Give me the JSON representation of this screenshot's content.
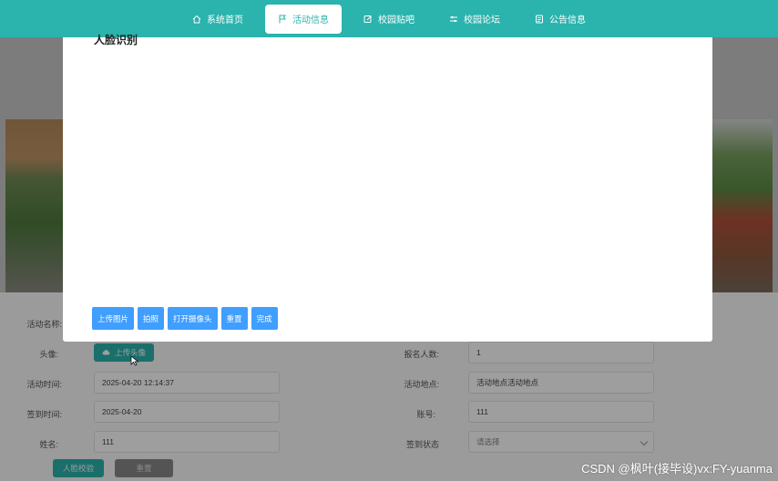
{
  "nav": {
    "items": [
      {
        "label": "系统首页",
        "icon": "home-icon",
        "active": false
      },
      {
        "label": "活动信息",
        "icon": "flag-icon",
        "active": true
      },
      {
        "label": "校园贴吧",
        "icon": "edit-icon",
        "active": false
      },
      {
        "label": "校园论坛",
        "icon": "sliders-icon",
        "active": false
      },
      {
        "label": "公告信息",
        "icon": "notice-icon",
        "active": false
      }
    ]
  },
  "modal": {
    "title": "人脸识别",
    "buttons": [
      "上传图片",
      "拍照",
      "打开摄像头",
      "重置",
      "完成"
    ]
  },
  "form": {
    "activity_name_label": "活动名称:",
    "avatar_label": "头像:",
    "upload_avatar_label": "上传头像",
    "activity_time_label": "活动时间:",
    "activity_time_value": "2025-04-20 12:14:37",
    "checkin_time_label": "签到时间:",
    "checkin_time_value": "2025-04-20",
    "name_label": "姓名:",
    "name_value": "111",
    "signup_count_label": "报名人数:",
    "signup_count_value": "1",
    "location_label": "活动地点:",
    "location_value": "活动地点活动地点",
    "account_label": "账号:",
    "account_value": "111",
    "checkin_status_label": "签到状态",
    "checkin_status_placeholder": "请选择",
    "face_verify_button": "人脸校验",
    "reset_button": "重置"
  },
  "watermark": "CSDN @枫叶(接毕设)vx:FY-yuanma",
  "colors": {
    "nav_bg": "#2bb3ad",
    "modal_button": "#409eff",
    "overlay": "rgba(0,0,0,0.38)"
  }
}
